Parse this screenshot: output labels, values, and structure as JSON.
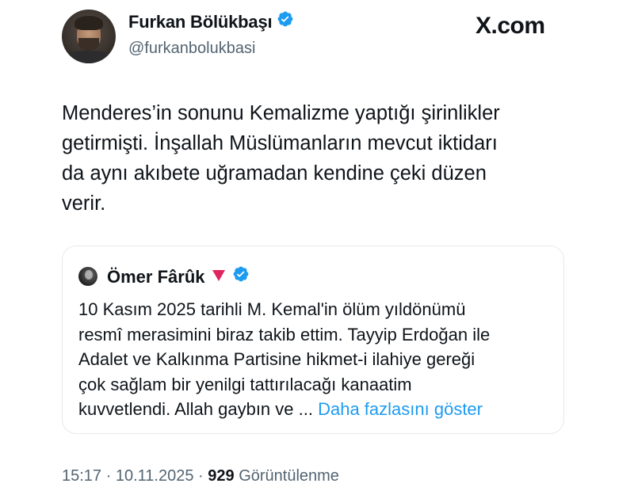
{
  "author": {
    "display_name": "Furkan Bölükbaşı",
    "handle": "@furkanbolukbasi",
    "verified_icon": "verified-badge-icon"
  },
  "site_logo": "X.com",
  "tweet": {
    "lines": [
      "Menderes’in sonunu Kemalizme yaptığı şirinlikler",
      "getirmişti. İnşallah Müslümanların mevcut iktidarı",
      "da aynı akıbete uğramadan kendine çeki düzen",
      "verir."
    ]
  },
  "quoted_tweet": {
    "author_name": "Ömer Fârûk",
    "flag_icon": "red-triangle-icon",
    "verified_icon": "verified-badge-icon",
    "lines": [
      "10 Kasım 2025 tarihli M. Kemal'in ölüm yıldönümü",
      "resmî merasimini biraz takib ettim. Tayyip Erdoğan ile",
      "Adalet ve Kalkınma Partisine hikmet-i ilahiye gereği",
      "çok sağlam bir yenilgi tattırılacağı kanaatim",
      "kuvvetlendi. Allah gaybın ve ..."
    ],
    "show_more": "Daha fazlasını göster"
  },
  "meta": {
    "time": "15:17",
    "separator": " · ",
    "date": "10.11.2025",
    "views_count": "929",
    "views_label": "Görüntülenme"
  },
  "colors": {
    "accent": "#1d9bf0",
    "secondary_text": "#536471",
    "primary_text": "#0f1419",
    "flag_red": "#e0245e"
  }
}
